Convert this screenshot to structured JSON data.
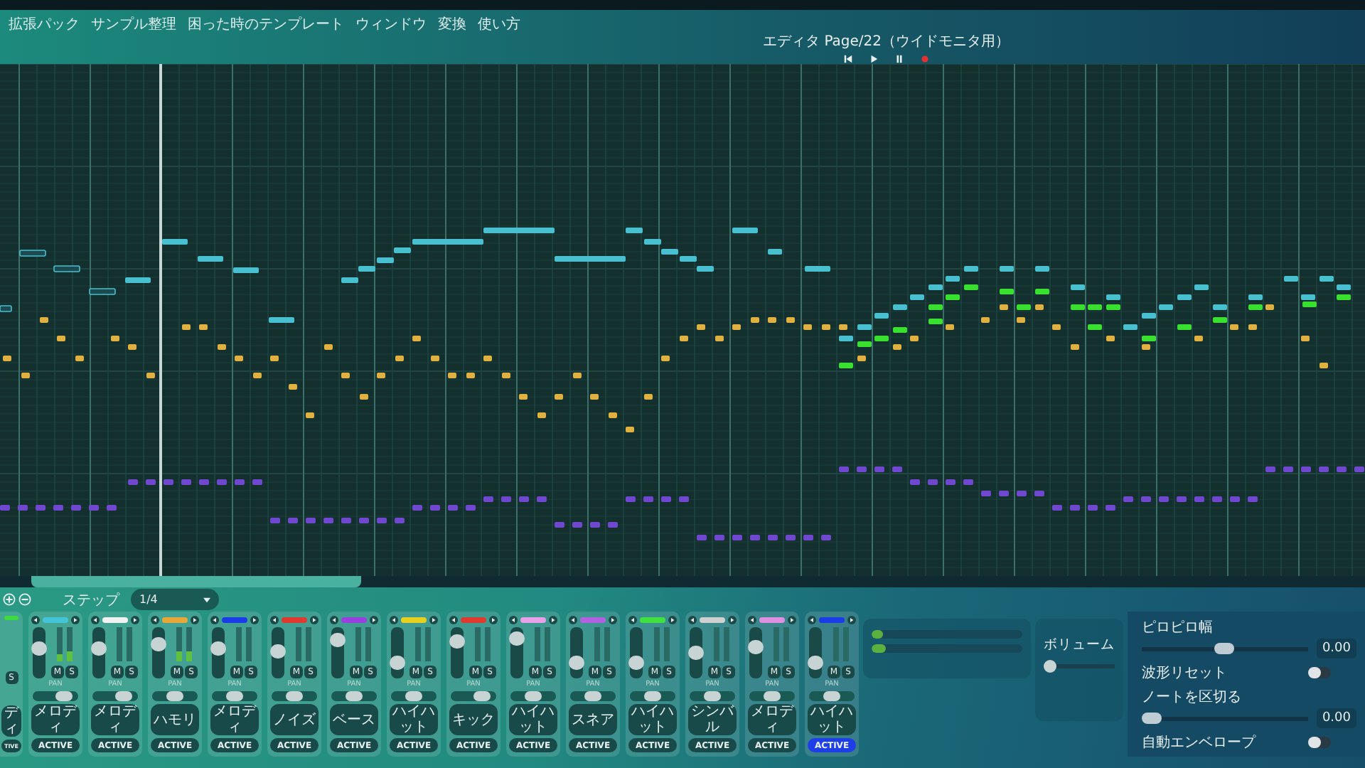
{
  "menu": [
    {
      "label": "拡張パック"
    },
    {
      "label": "サンプル整理"
    },
    {
      "label": "困った時のテンプレート"
    },
    {
      "label": "ウィンドウ"
    },
    {
      "label": "変換"
    },
    {
      "label": "使い方"
    }
  ],
  "editor": {
    "title": "エディタ Page/22（ウイドモニタ用）",
    "transport": [
      {
        "kind": "skip-back"
      },
      {
        "kind": "play"
      },
      {
        "kind": "pause"
      },
      {
        "kind": "record"
      }
    ]
  },
  "toolbar": {
    "step_label": "ステップ",
    "step_value": "1/4"
  },
  "channels": [
    {
      "kind": "partial",
      "color": "#3ddc3d",
      "name": "ディ",
      "solo": "S",
      "button": "TIVE",
      "selected": false
    },
    {
      "kind": "full",
      "color": "#45c4d8",
      "fader": {
        "level": 0.6
      },
      "meters": [
        {
          "level": 0.2
        },
        {
          "level": 0.3
        }
      ],
      "mute": "M",
      "solo": "S",
      "pan_label": "PAN",
      "pan": {
        "level": 0.8
      },
      "name": "メロディ",
      "button": "ACTIVE",
      "selected": false
    },
    {
      "kind": "full",
      "color": "#f2f2f2",
      "fader": {
        "level": 0.6
      },
      "meters": [
        {
          "level": 0
        },
        {
          "level": 0
        }
      ],
      "mute": "M",
      "solo": "S",
      "pan_label": "PAN",
      "pan": {
        "level": 0.8
      },
      "name": "メロディ",
      "button": "ACTIVE",
      "selected": false
    },
    {
      "kind": "full",
      "color": "#e8a838",
      "fader": {
        "level": 0.75
      },
      "meters": [
        {
          "level": 0.3
        },
        {
          "level": 0.3
        }
      ],
      "mute": "M",
      "solo": "S",
      "pan_label": "PAN",
      "pan": {
        "level": 0.5
      },
      "name": "ハモリ",
      "button": "ACTIVE",
      "selected": false
    },
    {
      "kind": "full",
      "color": "#1a3ce8",
      "fader": {
        "level": 0.6
      },
      "meters": [
        {
          "level": 0
        },
        {
          "level": 0
        }
      ],
      "mute": "M",
      "solo": "S",
      "pan_label": "PAN",
      "pan": {
        "level": 0.5
      },
      "name": "メロディ",
      "button": "ACTIVE",
      "selected": false
    },
    {
      "kind": "full",
      "color": "#e03a30",
      "fader": {
        "level": 0.55
      },
      "meters": [
        {
          "level": 0
        },
        {
          "level": 0
        }
      ],
      "mute": "M",
      "solo": "S",
      "pan_label": "PAN",
      "pan": {
        "level": 0.5
      },
      "name": "ノイズ",
      "button": "ACTIVE",
      "selected": false
    },
    {
      "kind": "full",
      "color": "#9a40e0",
      "fader": {
        "level": 0.85
      },
      "meters": [
        {
          "level": 0
        },
        {
          "level": 0
        }
      ],
      "mute": "M",
      "solo": "S",
      "pan_label": "PAN",
      "pan": {
        "level": 0.5
      },
      "name": "ベース",
      "button": "ACTIVE",
      "selected": false
    },
    {
      "kind": "full",
      "color": "#e8d020",
      "fader": {
        "level": 0.25
      },
      "meters": [
        {
          "level": 0
        },
        {
          "level": 0
        }
      ],
      "mute": "M",
      "solo": "S",
      "pan_label": "PAN",
      "pan": {
        "level": 0.5
      },
      "name": "ハイハット",
      "button": "ACTIVE",
      "selected": false
    },
    {
      "kind": "full",
      "color": "#e03a30",
      "fader": {
        "level": 0.8
      },
      "meters": [
        {
          "level": 0
        },
        {
          "level": 0
        }
      ],
      "mute": "M",
      "solo": "S",
      "pan_label": "PAN",
      "pan": {
        "level": 0.8
      },
      "name": "キック",
      "button": "ACTIVE",
      "selected": false
    },
    {
      "kind": "full",
      "color": "#e8a0e8",
      "fader": {
        "level": 0.9
      },
      "meters": [
        {
          "level": 0
        },
        {
          "level": 0
        }
      ],
      "mute": "M",
      "solo": "S",
      "pan_label": "PAN",
      "pan": {
        "level": 0.5
      },
      "name": "ハイハット",
      "button": "ACTIVE",
      "selected": false
    },
    {
      "kind": "full",
      "color": "#b060e0",
      "fader": {
        "level": 0.25
      },
      "meters": [
        {
          "level": 0
        },
        {
          "level": 0
        }
      ],
      "mute": "M",
      "solo": "S",
      "pan_label": "PAN",
      "pan": {
        "level": 0.5
      },
      "name": "スネア",
      "button": "ACTIVE",
      "selected": false
    },
    {
      "kind": "full",
      "color": "#40e040",
      "fader": {
        "level": 0.25
      },
      "meters": [
        {
          "level": 0
        },
        {
          "level": 0
        }
      ],
      "mute": "M",
      "solo": "S",
      "pan_label": "PAN",
      "pan": {
        "level": 0.5
      },
      "name": "ハイハット",
      "button": "ACTIVE",
      "selected": false
    },
    {
      "kind": "full",
      "color": "#d0d0d0",
      "fader": {
        "level": 0.5
      },
      "meters": [
        {
          "level": 0
        },
        {
          "level": 0
        }
      ],
      "mute": "M",
      "solo": "S",
      "pan_label": "PAN",
      "pan": {
        "level": 0.5
      },
      "name": "シンバル",
      "button": "ACTIVE",
      "selected": false
    },
    {
      "kind": "full",
      "color": "#e090e0",
      "fader": {
        "level": 0.65
      },
      "meters": [
        {
          "level": 0
        },
        {
          "level": 0
        }
      ],
      "mute": "M",
      "solo": "S",
      "pan_label": "PAN",
      "pan": {
        "level": 0.5
      },
      "name": "メロディ",
      "button": "ACTIVE",
      "selected": false
    },
    {
      "kind": "full",
      "color": "#1a3ce8",
      "fader": {
        "level": 0.25
      },
      "meters": [
        {
          "level": 0
        },
        {
          "level": 0
        }
      ],
      "mute": "M",
      "solo": "S",
      "pan_label": "PAN",
      "pan": {
        "level": 0.5
      },
      "name": "ハイハット",
      "button": "ACTIVE",
      "selected": true
    }
  ],
  "bus_meters": [
    {
      "level": 0.08
    },
    {
      "level": 0.09
    }
  ],
  "volume": {
    "label": "ボリューム",
    "level": 0
  },
  "settings": [
    {
      "kind": "slider",
      "label": "ピロピロ幅",
      "level": 0.5,
      "value": "0.00"
    },
    {
      "kind": "toggle",
      "label": "波形リセット",
      "on": false
    },
    {
      "kind": "slider",
      "label": "ノートを区切る",
      "level": 0,
      "value": "0.00"
    },
    {
      "kind": "toggle",
      "label": "自動エンベロープ",
      "on": false
    }
  ]
}
